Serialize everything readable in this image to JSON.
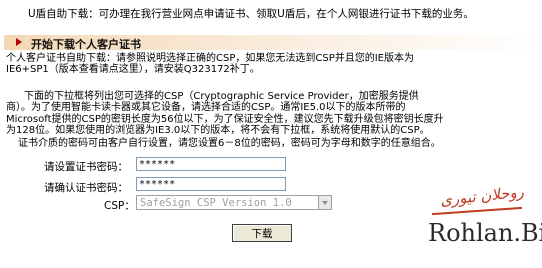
{
  "intro": "U盾自助下载：可办理在我行营业网点申请证书、领取U盾后，在个人网银进行证书下载的业务。",
  "section": {
    "title": "开始下载个人客户证书"
  },
  "paragraphs": {
    "p1_line1": "个人客户证书自助下载：请参照说明选择正确的CSP，如果您无法选到CSP并且您的IE版本为",
    "p1_line2": "IE6+SP1（版本查看请点这里），请安装Q323172补丁。",
    "p2_line1": "下面的下拉框将列出您可选择的CSP（Cryptographic Service Provider，加密服务提供",
    "p2_line2": "商）。为了使用智能卡读卡器或其它设备，请选择合适的CSP。通常IE5.0以下的版本所带的",
    "p2_line3": "Microsoft提供的CSP的密钥长度为56位以下，为了保证安全性，建议您先下载升级包将密钥长度升",
    "p2_line4": "为128位。如果您使用的浏览器为IE3.0以下的版本，将不会有下拉框，系统将使用默认的CSP。",
    "p3": "证书介质的密码可由客户自行设置，请您设置6－8位的密码，密码可为字母和数字的任意组合。"
  },
  "form": {
    "set_password_label": "请设置证书密码：",
    "set_password_value": "******",
    "confirm_password_label": "请确认证书密码：",
    "confirm_password_value": "******",
    "csp_label": "CSP：",
    "csp_value": "SafeSign CSP Version 1.0",
    "download_button": "下载"
  },
  "watermark": {
    "script": "روحلان تیوری",
    "text": "Rohlan.Biz"
  }
}
